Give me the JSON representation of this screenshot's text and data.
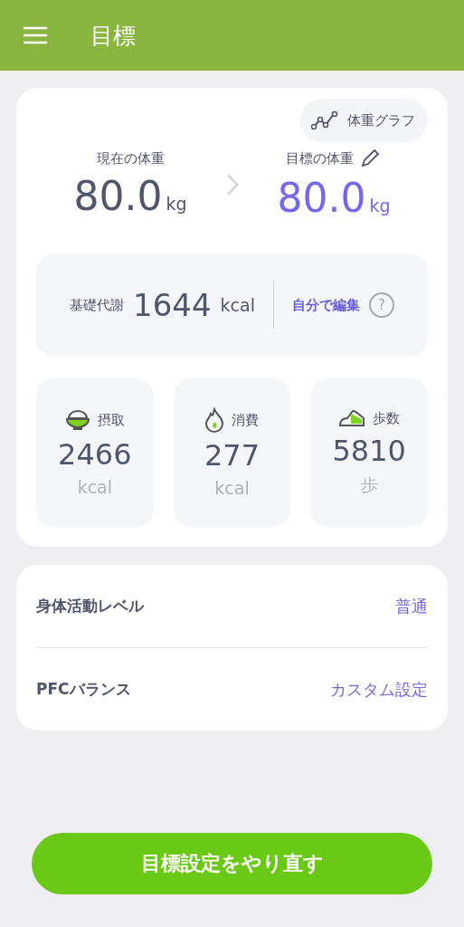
{
  "header": {
    "title": "目標"
  },
  "graph_button": {
    "label": "体重グラフ"
  },
  "weights": [
    {
      "kind": "current",
      "label": "現在の体重",
      "value": "80.0",
      "unit": "kg",
      "editable": false
    },
    {
      "kind": "target",
      "label": "目標の体重",
      "value": "80.0",
      "unit": "kg",
      "editable": true
    }
  ],
  "bmr": {
    "label": "基礎代謝",
    "value": "1644",
    "unit": "kcal",
    "edit_link": "自分で編集",
    "help": "?"
  },
  "stats": [
    {
      "kind": "intake",
      "label": "摂取",
      "value": "2466",
      "unit": "kcal"
    },
    {
      "kind": "burn",
      "label": "消費",
      "value": "277",
      "unit": "kcal"
    },
    {
      "kind": "steps",
      "label": "歩数",
      "value": "5810",
      "unit": "歩"
    }
  ],
  "settings": [
    {
      "label": "身体活動レベル",
      "value": "普通"
    },
    {
      "label": "PFCバランス",
      "value": "カスタム設定"
    }
  ],
  "reset_button": {
    "label": "目標設定をやり直す"
  }
}
